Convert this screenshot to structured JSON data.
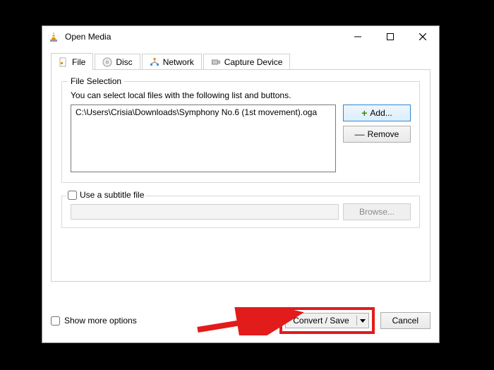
{
  "window": {
    "title": "Open Media"
  },
  "tabs": {
    "file": "File",
    "disc": "Disc",
    "network": "Network",
    "capture": "Capture Device"
  },
  "fileSelection": {
    "legend": "File Selection",
    "hint": "You can select local files with the following list and buttons.",
    "files": [
      "C:\\Users\\Crisia\\Downloads\\Symphony No.6 (1st movement).oga"
    ],
    "addLabel": "Add...",
    "removeLabel": "Remove"
  },
  "subtitle": {
    "label": "Use a subtitle file",
    "browse": "Browse..."
  },
  "footer": {
    "showMore": "Show more options",
    "convert": "Convert / Save",
    "cancel": "Cancel"
  }
}
